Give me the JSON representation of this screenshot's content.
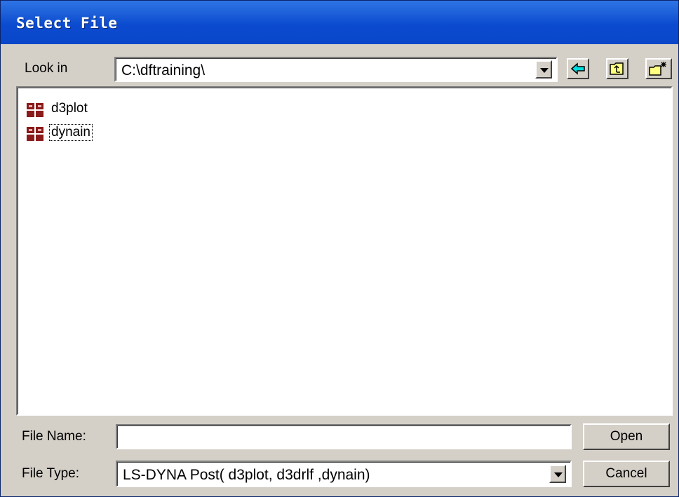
{
  "window": {
    "title": "Select File"
  },
  "look_in": {
    "label": "Look in",
    "value": "C:\\dftraining\\"
  },
  "toolbar": {
    "back_icon": "back-arrow-icon",
    "up_icon": "up-folder-icon",
    "new_folder_icon": "new-folder-icon"
  },
  "files": [
    {
      "name": "d3plot",
      "icon": "grid-file-icon"
    },
    {
      "name": "dynain",
      "icon": "grid-file-icon"
    }
  ],
  "file_name": {
    "label": "File Name:",
    "value": ""
  },
  "file_type": {
    "label": "File Type:",
    "value": "LS-DYNA Post( d3plot, d3drlf ,dynain)"
  },
  "buttons": {
    "open": "Open",
    "cancel": "Cancel"
  },
  "colors": {
    "title_bar": "#0a46c8",
    "file_icon": "#8b1a1a",
    "toolbar_icon": "#ffff80"
  }
}
